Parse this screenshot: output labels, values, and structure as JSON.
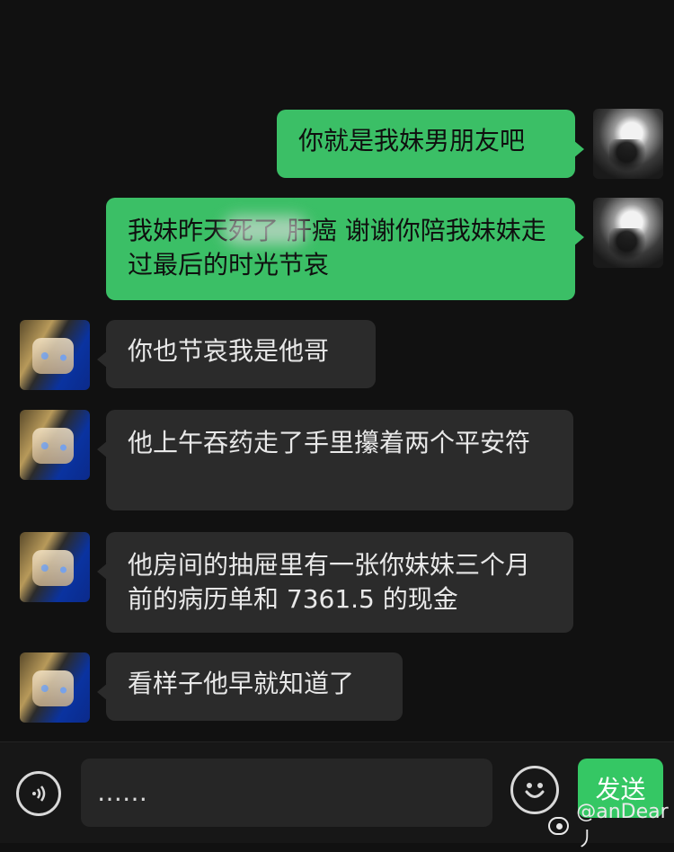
{
  "messages": [
    {
      "side": "me",
      "text": "你就是我妹男朋友吧"
    },
    {
      "side": "me",
      "text": "我妹昨天死了 肝癌 谢谢你陪我妹妹走过最后的时光节哀"
    },
    {
      "side": "other",
      "text": "你也节哀我是他哥"
    },
    {
      "side": "other",
      "text": "他上午吞药走了手里攥着两个平安符"
    },
    {
      "side": "other",
      "text": "他房间的抽屉里有一张你妹妹三个月前的病历单和 7361.5 的现金"
    },
    {
      "side": "other",
      "text": "看样子他早就知道了"
    }
  ],
  "input": {
    "value": "……",
    "send_label": "发送"
  },
  "icons": {
    "voice": "voice-icon",
    "emoji": "emoji-icon",
    "watermark": "weibo-icon"
  },
  "watermark": {
    "text": "@anDear丿"
  },
  "colors": {
    "background": "#111111",
    "my_bubble": "#3bbf66",
    "their_bubble": "#2b2b2b",
    "send_button": "#35c764"
  }
}
